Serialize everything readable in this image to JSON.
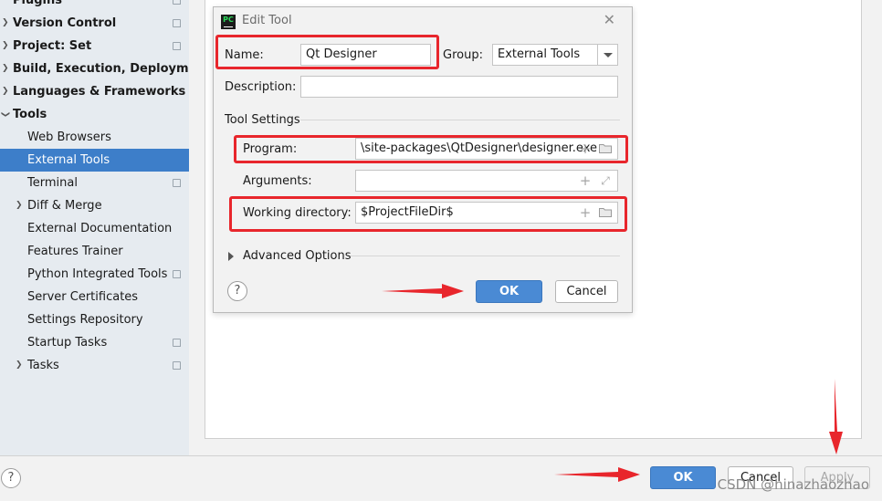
{
  "sidebar": {
    "items": [
      {
        "label": "Plugins",
        "bold": true
      },
      {
        "label": "Version Control",
        "bold": true
      },
      {
        "label": "Project: Set",
        "bold": true
      },
      {
        "label": "Build, Execution, Deployment",
        "bold": true
      },
      {
        "label": "Languages & Frameworks",
        "bold": true
      },
      {
        "label": "Tools",
        "bold": true
      },
      {
        "label": "Web Browsers"
      },
      {
        "label": "External Tools",
        "selected": true
      },
      {
        "label": "Terminal"
      },
      {
        "label": "Diff & Merge"
      },
      {
        "label": "External Documentation"
      },
      {
        "label": "Features Trainer"
      },
      {
        "label": "Python Integrated Tools"
      },
      {
        "label": "Server Certificates"
      },
      {
        "label": "Settings Repository"
      },
      {
        "label": "Startup Tasks"
      },
      {
        "label": "Tasks"
      }
    ]
  },
  "dialog": {
    "title": "Edit Tool",
    "app_icon_text": "PC",
    "close_glyph": "✕",
    "name_label": "Name:",
    "name_value": "Qt Designer",
    "group_label": "Group:",
    "group_value": "External Tools",
    "description_label": "Description:",
    "description_value": "",
    "tool_settings_label": "Tool Settings",
    "program_label": "Program:",
    "program_value": "\\site-packages\\QtDesigner\\designer.exe",
    "arguments_label": "Arguments:",
    "arguments_value": "",
    "working_dir_label": "Working directory:",
    "working_dir_value": "$ProjectFileDir$",
    "advanced_label": "Advanced Options",
    "ok_label": "OK",
    "cancel_label": "Cancel",
    "help_glyph": "?"
  },
  "footer": {
    "help_glyph": "?",
    "ok_label": "OK",
    "cancel_label": "Cancel",
    "apply_label": "Apply"
  },
  "watermark": "CSDN @hinazhaozhao",
  "colors": {
    "accent": "#4a8ad4",
    "selection": "#3d7ec9",
    "annotation_red": "#e8262c"
  }
}
